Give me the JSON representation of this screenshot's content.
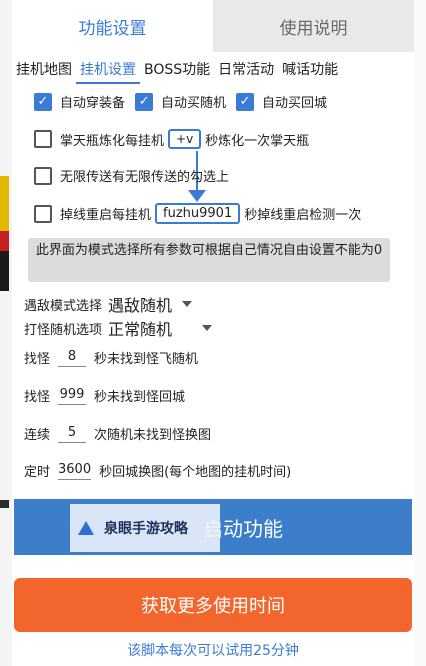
{
  "main_tabs": [
    {
      "label": "功能设置"
    },
    {
      "label": "使用说明"
    }
  ],
  "sub_tabs": [
    {
      "label": "挂机地图"
    },
    {
      "label": "挂机设置"
    },
    {
      "label": "BOSS功能"
    },
    {
      "label": "日常活动"
    },
    {
      "label": "喊话功能"
    }
  ],
  "auto_options": [
    {
      "label": "自动穿装备",
      "checked": true
    },
    {
      "label": "自动买随机",
      "checked": true
    },
    {
      "label": "自动买回城",
      "checked": true
    }
  ],
  "refine": {
    "prefix": "掌天瓶炼化每挂机",
    "input": "+v",
    "suffix": "秒炼化一次掌天瓶"
  },
  "teleport": {
    "label": "无限传送有无限传送的勾选上"
  },
  "reconnect": {
    "prefix": "掉线重启每挂机",
    "input": "fuzhu9901",
    "suffix": "秒掉线重启检测一次"
  },
  "notice": "此界面为模式选择所有参数可根据自己情况自由设置不能为0",
  "selects": {
    "enemy_mode": {
      "label": "遇敌模式选择",
      "value": "遇敌随机"
    },
    "random_option": {
      "label": "打怪随机选项",
      "value": "正常随机"
    }
  },
  "numeric_rows": [
    {
      "prefix": "找怪",
      "value": "8",
      "suffix": "秒未找到怪飞随机"
    },
    {
      "prefix": "找怪",
      "value": "999",
      "suffix": "秒未找到怪回城"
    },
    {
      "prefix": "连续",
      "value": "5",
      "suffix": "次随机未找到怪换图"
    },
    {
      "prefix": "定时",
      "value": "3600",
      "suffix": "秒回城换图(每个地图的挂机时间)"
    }
  ],
  "start_button": "启动功能",
  "watermark": "泉眼手游攻略",
  "more_time_button": "获取更多使用时间",
  "footer": "该脚本每次可以试用25分钟",
  "colors": {
    "accent": "#3a7bd5",
    "start_button": "#3d7ecb",
    "more_button": "#f2662d"
  }
}
